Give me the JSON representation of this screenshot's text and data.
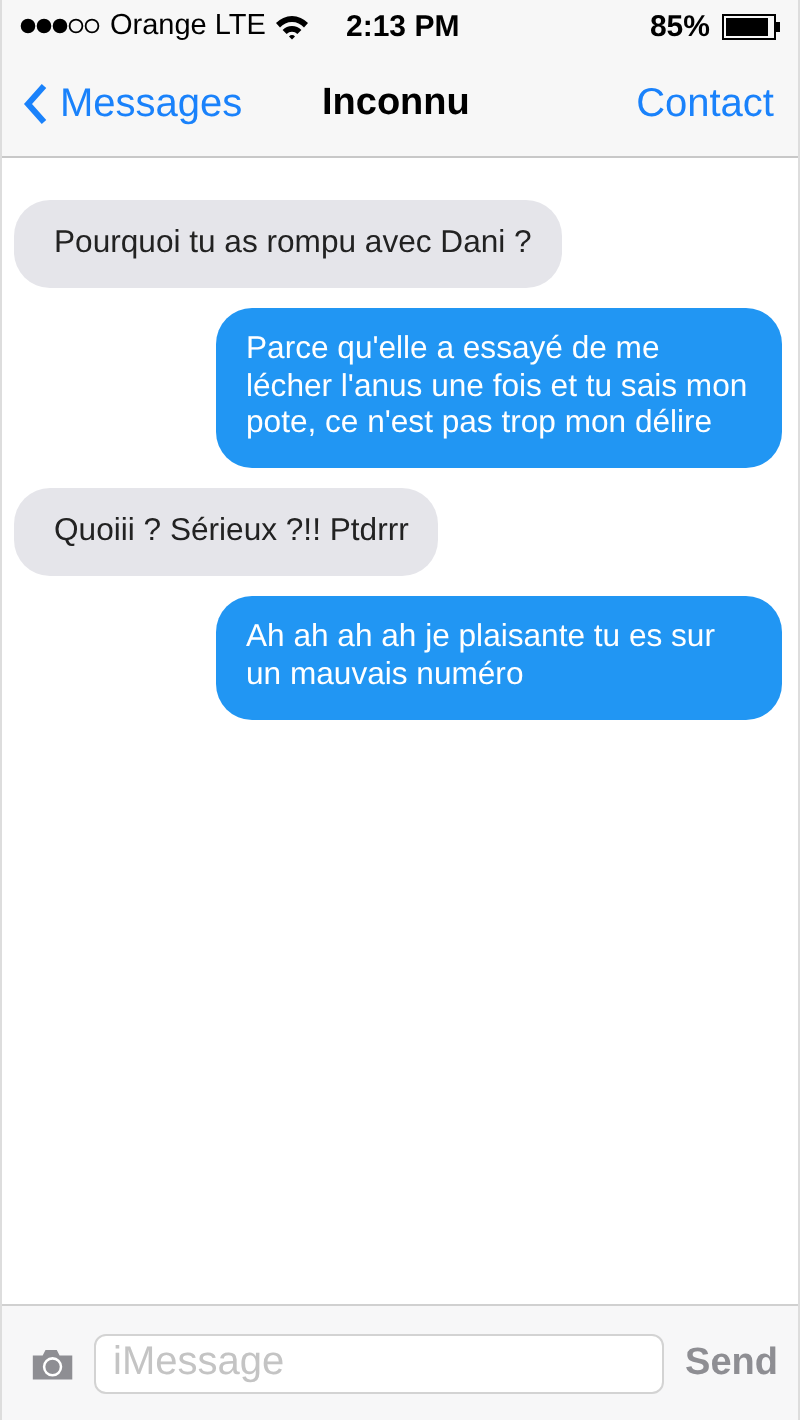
{
  "status_bar": {
    "carrier": "Orange",
    "network": "LTE",
    "time": "2:13 PM",
    "battery": "85%"
  },
  "nav": {
    "back": "Messages",
    "title": "Inconnu",
    "action": "Contact"
  },
  "messages": [
    {
      "kind": "received",
      "text": "Pourquoi tu as rompu avec Dani ?"
    },
    {
      "kind": "sent",
      "text": "Parce qu'elle a essayé de me lécher l'anus une fois et tu sais mon pote, ce n'est pas trop mon délire"
    },
    {
      "kind": "received",
      "text": "Quoiii ? Sérieux ?!! Ptdrrr"
    },
    {
      "kind": "sent",
      "text": "Ah ah ah ah je plaisante tu es sur un mauvais numéro"
    }
  ],
  "composer": {
    "placeholder": "iMessage",
    "send": "Send",
    "send_disabled": true
  }
}
